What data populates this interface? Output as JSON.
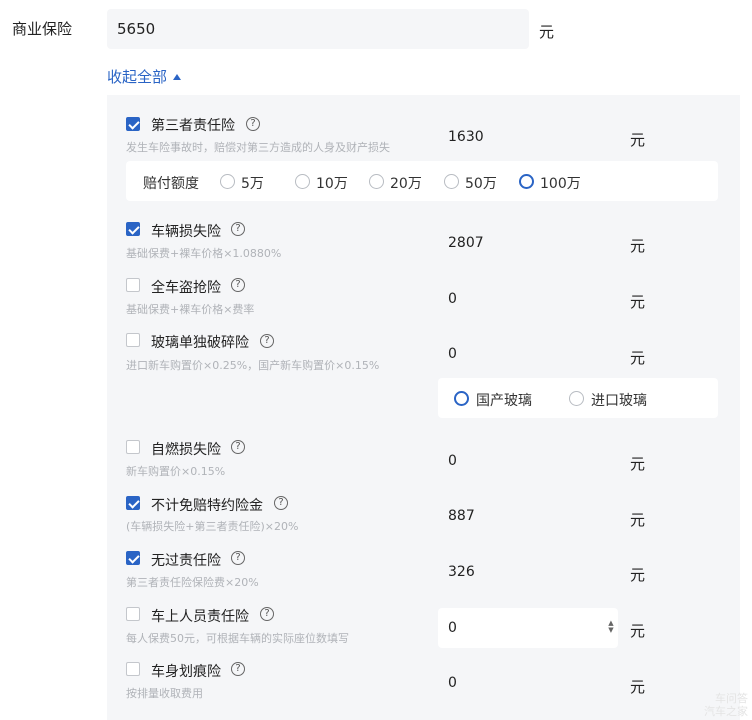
{
  "header": {
    "label": "商业保险",
    "value": "5650",
    "unit": "元"
  },
  "collapse_label": "收起全部",
  "items": [
    {
      "name": "第三者责任险",
      "subtitle": "发生车险事故时，赔偿对第三方造成的人身及财产损失",
      "checked": true,
      "value": "1630",
      "unit": "元"
    },
    {
      "name": "车辆损失险",
      "subtitle": "基础保费+裸车价格×1.0880%",
      "checked": true,
      "value": "2807",
      "unit": "元"
    },
    {
      "name": "全车盗抢险",
      "subtitle": "基础保费+裸车价格×费率",
      "checked": false,
      "value": "0",
      "unit": "元"
    },
    {
      "name": "玻璃单独破碎险",
      "subtitle": "进口新车购置价×0.25%，国产新车购置价×0.15%",
      "checked": false,
      "value": "0",
      "unit": "元"
    },
    {
      "name": "自燃损失险",
      "subtitle": "新车购置价×0.15%",
      "checked": false,
      "value": "0",
      "unit": "元"
    },
    {
      "name": "不计免赔特约险金",
      "subtitle": "(车辆损失险+第三者责任险)×20%",
      "checked": true,
      "value": "887",
      "unit": "元"
    },
    {
      "name": "无过责任险",
      "subtitle": "第三者责任险保险费×20%",
      "checked": true,
      "value": "326",
      "unit": "元"
    },
    {
      "name": "车上人员责任险",
      "subtitle": "每人保费50元，可根据车辆的实际座位数填写",
      "checked": false,
      "value": "0",
      "unit": "元"
    },
    {
      "name": "车身划痕险",
      "subtitle": "按排量收取费用",
      "checked": false,
      "value": "0",
      "unit": "元"
    }
  ],
  "coverage": {
    "label": "赔付额度",
    "options": [
      "5万",
      "10万",
      "20万",
      "50万",
      "100万"
    ],
    "selected": "100万"
  },
  "glass": {
    "options": [
      "国产玻璃",
      "进口玻璃"
    ],
    "selected": "国产玻璃"
  },
  "help_glyph": "?",
  "watermark": [
    "车问答",
    "汽车之家"
  ],
  "colors": {
    "accent": "#2a64c5",
    "panel": "#f5f6f8",
    "subtitle": "#b0b3b8"
  }
}
